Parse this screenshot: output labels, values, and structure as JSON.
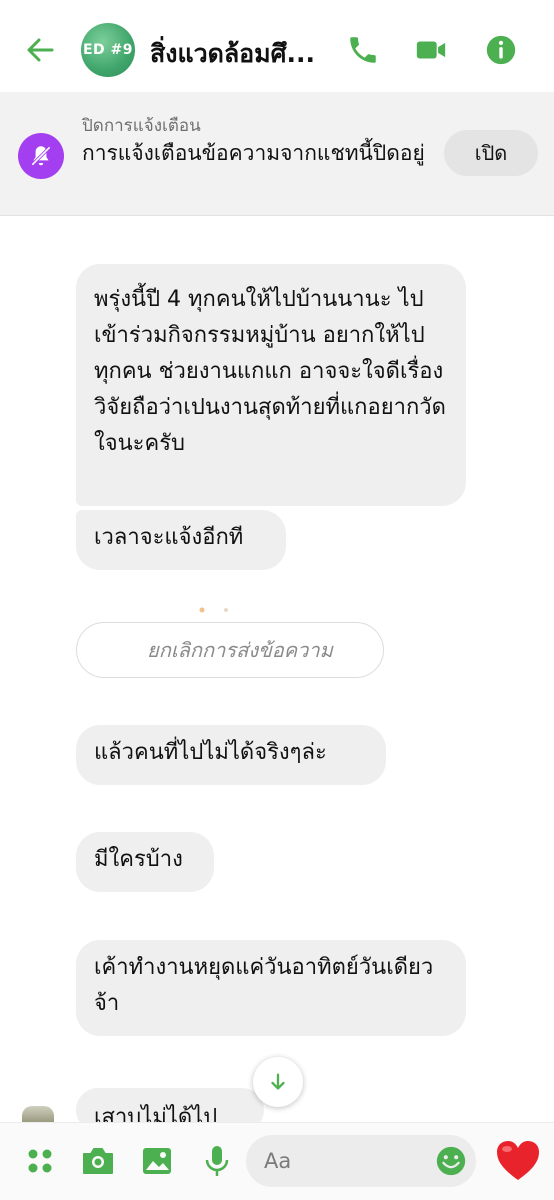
{
  "header": {
    "avatar_text": "ED #9",
    "title": "สิ่งแวดล้อมศึ...",
    "accent_color": "#4caf50"
  },
  "mute_banner": {
    "caption": "ปิดการแจ้งเตือน",
    "text": "การแจ้งเตือนข้อความจากแชทนี้ปิดอยู่",
    "button_label": "เปิด",
    "badge_color": "#a33ff0"
  },
  "messages": [
    {
      "text": "พรุ่งนี้ปี 4 ทุกคนให้ไปบ้านนานะ ไปเข้าร่วมกิจกรรมหมู่บ้าน อยากให้ไปทุกคน ช่วยงานแกแก อาจจะใจดีเรื่องวิจัยถือว่าเปนงานสุดท้ายที่แกอยากวัดใจนะครับ"
    },
    {
      "text": "เวลาจะแจ้งอีกที"
    },
    {
      "text": "แล้วคนที่ไปไม่ได้จริงๆล่ะ"
    },
    {
      "text": "มีใครบ้าง"
    },
    {
      "text": "เค้าทำงานหยุดแค่วันอาทิตย์วันเดียวจ้า"
    },
    {
      "text": "เสาบไม่ได้ไปเด้อ"
    }
  ],
  "unsent_notice": "ยกเลิกการส่งข้อความ",
  "composer": {
    "placeholder": "Aa"
  },
  "icons": {
    "back": "arrow-left-icon",
    "phone": "phone-icon",
    "video": "video-icon",
    "info": "info-icon",
    "mute": "bell-off-icon",
    "apps": "apps-icon",
    "camera": "camera-icon",
    "gallery": "image-icon",
    "mic": "microphone-icon",
    "emoji": "emoji-icon",
    "like": "heart-icon",
    "scroll": "arrow-down-icon"
  }
}
